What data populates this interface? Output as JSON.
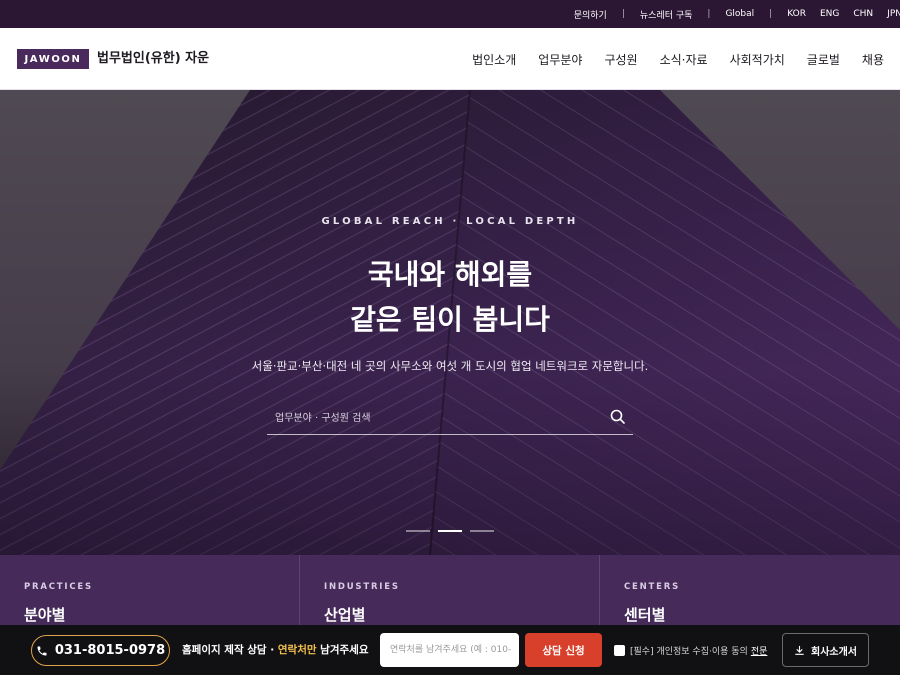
{
  "topbar": {
    "links": [
      "문의하기",
      "뉴스레터 구독",
      "Global"
    ],
    "separator": "|",
    "languages": [
      "KOR",
      "ENG",
      "CHN",
      "JPN"
    ]
  },
  "header": {
    "logo_text": "JAWOON",
    "firm_name": "법무법인(유한) 자운",
    "nav": [
      "법인소개",
      "업무분야",
      "구성원",
      "소식·자료",
      "사회적가치",
      "글로벌",
      "채용"
    ]
  },
  "hero": {
    "eyebrow": "GLOBAL REACH · LOCAL DEPTH",
    "title_line1": "국내와 해외를",
    "title_line2": "같은 팀이 봅니다",
    "subtitle": "서울·판교·부산·대전 네 곳의 사무소와 여섯 개 도시의 협업 네트워크로 자문합니다.",
    "search_placeholder": "업무분야 · 구성원 검색",
    "slides_total": 3,
    "slide_active": 2
  },
  "categories": [
    {
      "en": "PRACTICES",
      "ko": "분야별"
    },
    {
      "en": "INDUSTRIES",
      "ko": "산업별"
    },
    {
      "en": "CENTERS",
      "ko": "센터별"
    }
  ],
  "cta_bar": {
    "phone": "031-8015-0978",
    "text_before": "홈페이지 제작 상담 · ",
    "text_highlight": "연락처만",
    "text_after": " 남겨주세요",
    "input_placeholder": "연락처를 남겨주세요 (예 : 010-",
    "submit_label": "상담 신청",
    "consent_label": "[필수] 개인정보 수집·이용 동의",
    "consent_link": "전문",
    "brochure_label": "회사소개서"
  },
  "colors": {
    "brand": "#4a2a5c",
    "topbar": "#2b1733",
    "category_strip": "#452a5a",
    "accent_orange": "#d9402b",
    "highlight_yellow": "#f2c14e"
  }
}
